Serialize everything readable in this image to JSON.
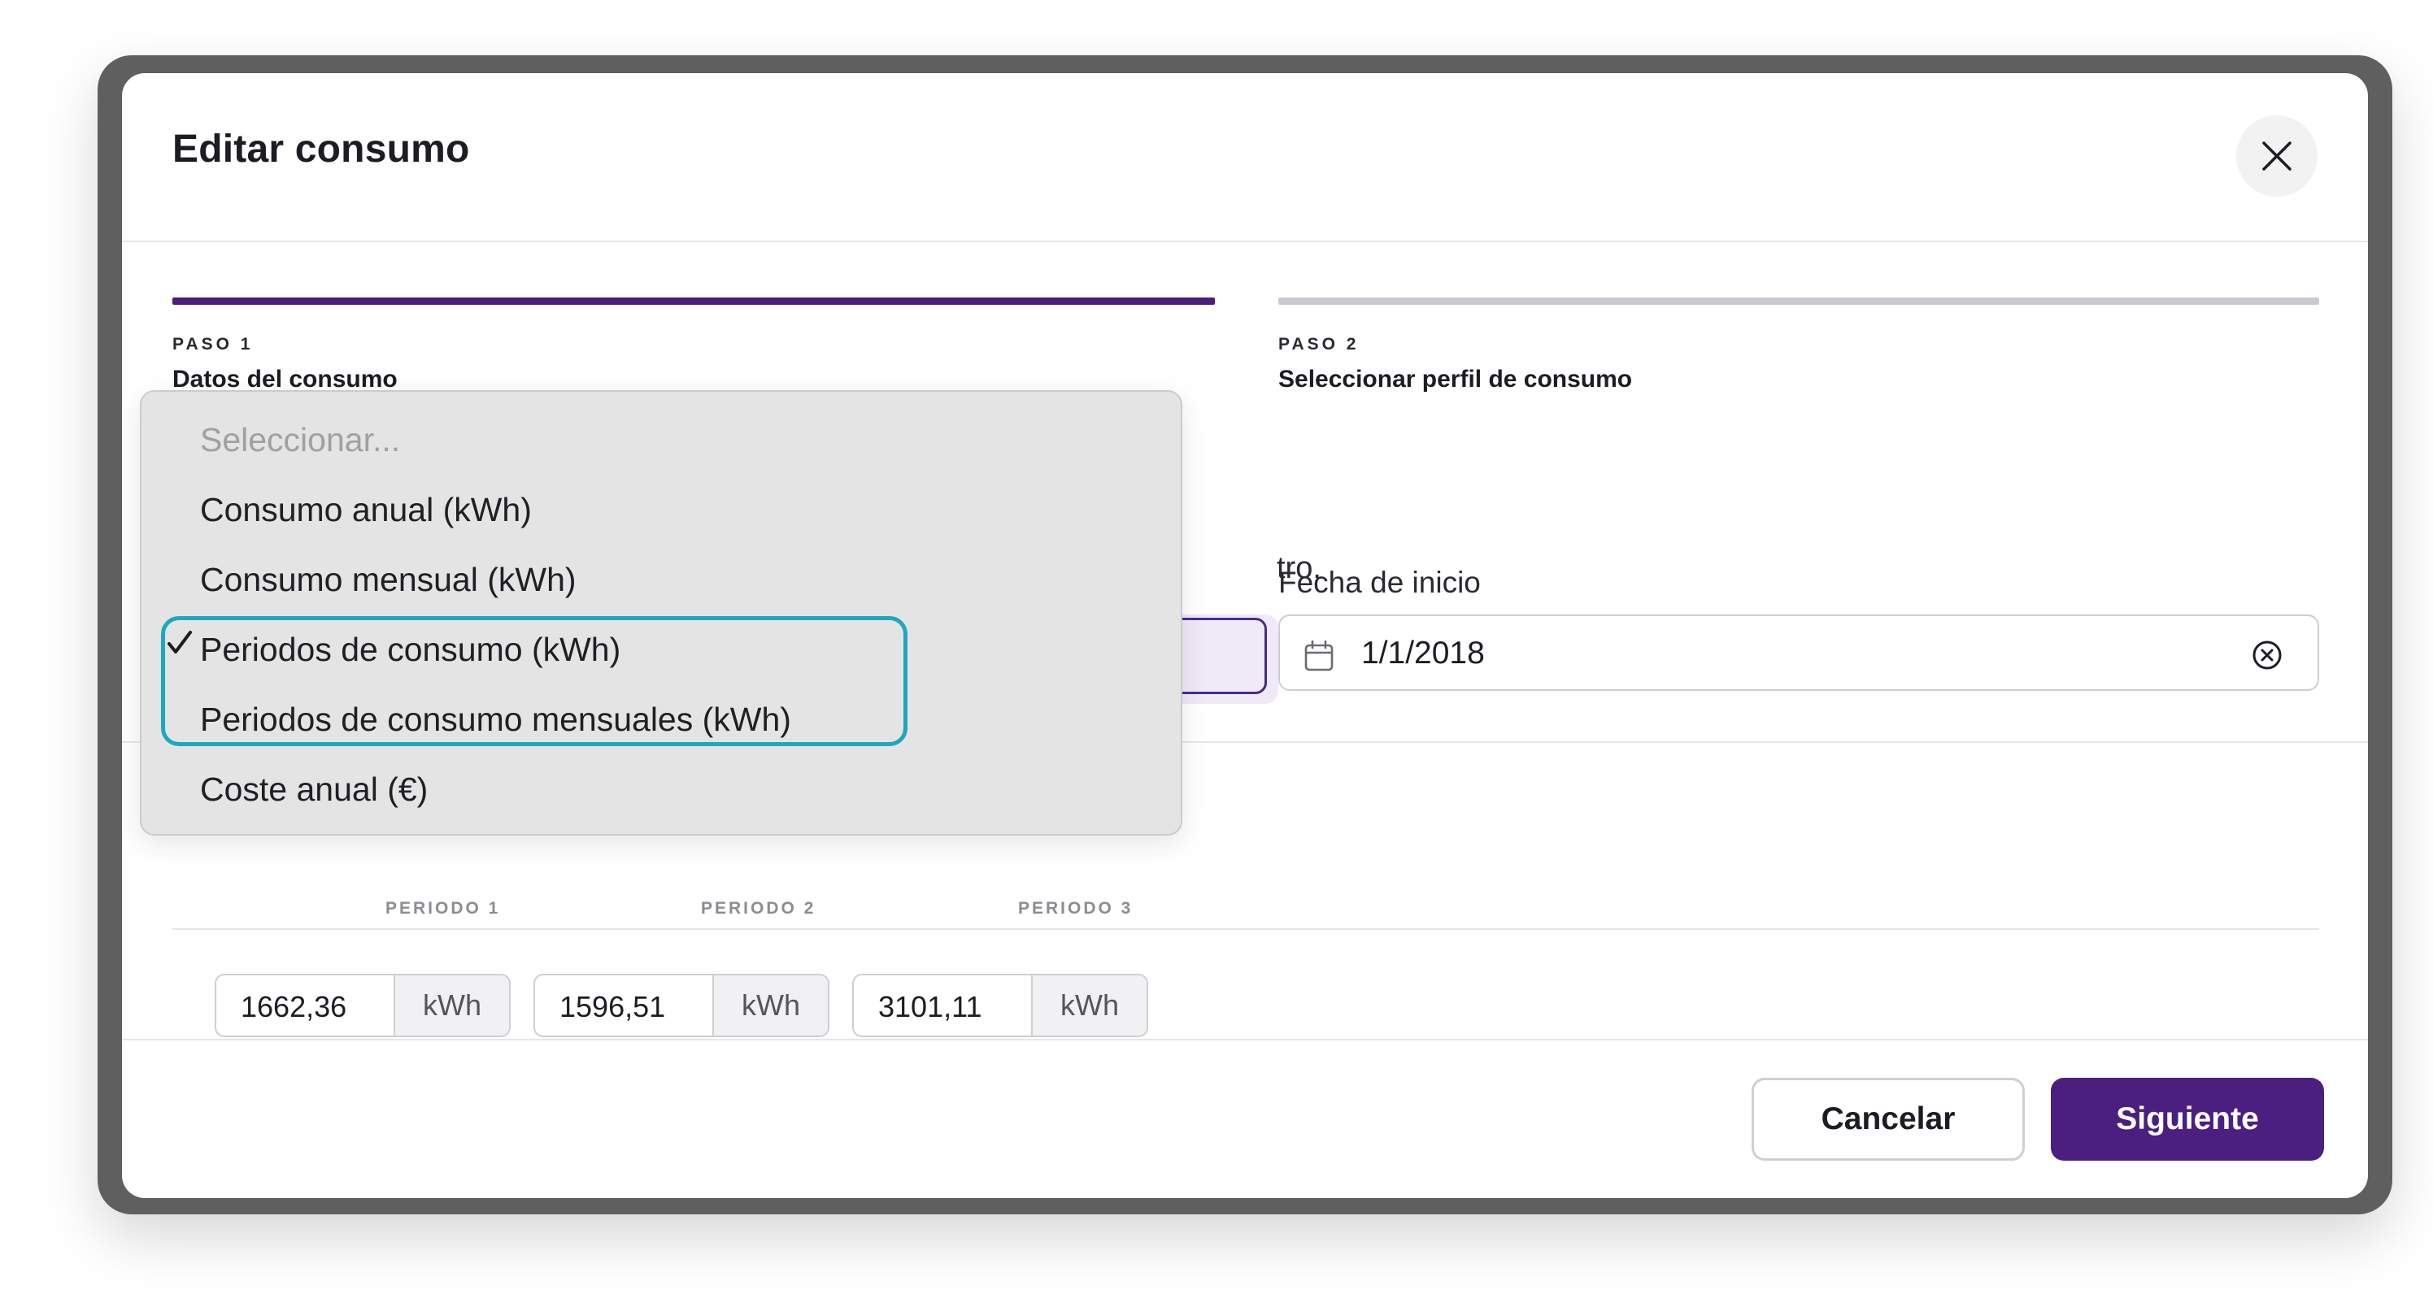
{
  "modal": {
    "title": "Editar consumo"
  },
  "steps": [
    {
      "label": "PASO 1",
      "name": "Datos del consumo",
      "color": "#4a1f7f"
    },
    {
      "label": "PASO 2",
      "name": "Seleccionar perfil de consumo",
      "color": "#c9c9ce"
    }
  ],
  "form": {
    "partial_text": "tro.",
    "start_date": {
      "label": "Fecha de inicio",
      "value": "1/1/2018"
    }
  },
  "periods": {
    "headers": [
      "PERIODO 1",
      "PERIODO 2",
      "PERIODO 3"
    ],
    "values": [
      {
        "value": "1662,36",
        "unit": "kWh"
      },
      {
        "value": "1596,51",
        "unit": "kWh"
      },
      {
        "value": "3101,11",
        "unit": "kWh"
      }
    ]
  },
  "dropdown": {
    "placeholder": "Seleccionar...",
    "options": [
      "Consumo anual (kWh)",
      "Consumo mensual (kWh)",
      "Periodos de consumo (kWh)",
      "Periodos de consumo mensuales (kWh)",
      "Coste anual (€)"
    ],
    "selected": "Periodos de consumo (kWh)",
    "highlight_color": "#1ea8bf"
  },
  "footer": {
    "cancel_label": "Cancelar",
    "next_label": "Siguiente"
  },
  "icons": {
    "close": "close-icon",
    "calendar": "calendar-icon",
    "clear": "clear-icon",
    "check": "check-icon"
  }
}
